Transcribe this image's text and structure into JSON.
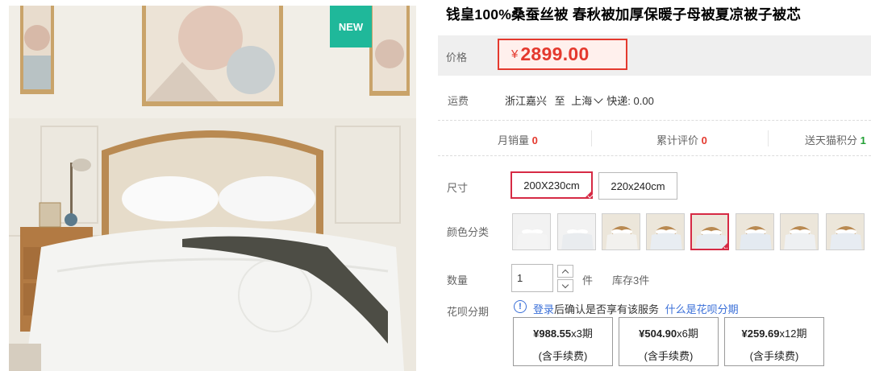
{
  "product": {
    "title": "钱皇100%桑蚕丝被 春秋被加厚保暖子母被夏凉被子被芯",
    "badge": "NEW",
    "image_alt": "bedroom with white quilt"
  },
  "price": {
    "label": "价格",
    "currency": "¥",
    "amount": "2899.00"
  },
  "shipping": {
    "label": "运费",
    "from": "浙江嘉兴",
    "to_prefix": "至",
    "to": "上海",
    "express": "快递: 0.00"
  },
  "stats": {
    "monthly_sales_label": "月销量",
    "monthly_sales": "0",
    "reviews_label": "累计评价",
    "reviews": "0",
    "points_label": "送天猫积分",
    "points": "1"
  },
  "size": {
    "label": "尺寸",
    "options": [
      "200X230cm",
      "220x240cm"
    ],
    "selected_index": 0
  },
  "color": {
    "label": "颜色分类",
    "selected_index": 4,
    "swatch_count": 8
  },
  "quantity": {
    "label": "数量",
    "value": "1",
    "unit": "件",
    "stock": "库存3件"
  },
  "huabei": {
    "label": "花呗分期",
    "notice_link": "登录",
    "notice_text": "后确认是否享有该服务",
    "help_link": "什么是花呗分期",
    "plans": [
      {
        "amount": "¥988.55",
        "term": "x3期",
        "fee": "(含手续费)"
      },
      {
        "amount": "¥504.90",
        "term": "x6期",
        "fee": "(含手续费)"
      },
      {
        "amount": "¥259.69",
        "term": "x12期",
        "fee": "(含手续费)"
      }
    ]
  },
  "colors": {
    "price_red": "#e4392e",
    "select_red": "#d62a44",
    "link_blue": "#3a6fd8",
    "badge_green": "#1fb89a"
  }
}
